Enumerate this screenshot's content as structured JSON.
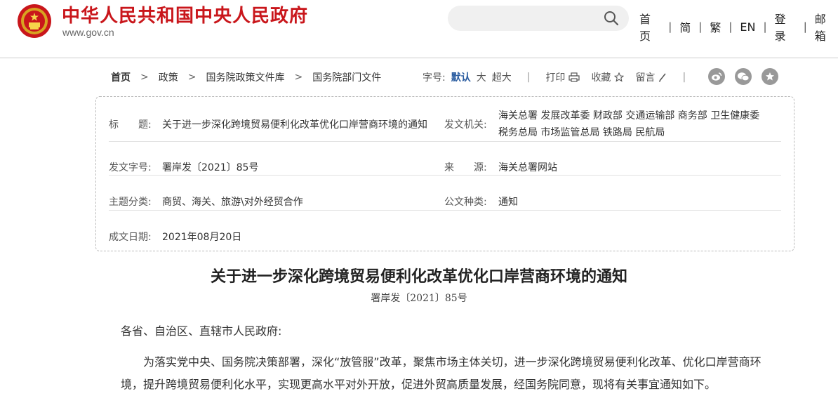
{
  "header": {
    "site_title": "中华人民共和国中央人民政府",
    "site_url": "www.gov.cn",
    "nav": [
      "首页",
      "简",
      "繁",
      "EN",
      "登录",
      "邮箱"
    ]
  },
  "breadcrumb": [
    "首页",
    "政策",
    "国务院政策文件库",
    "国务院部门文件"
  ],
  "toolbar": {
    "font_label": "字号:",
    "font_sizes": [
      "默认",
      "大",
      "超大"
    ],
    "print": "打印",
    "favorite": "收藏",
    "comment": "留言"
  },
  "info": {
    "title_label": "标　　题:",
    "title_value": "关于进一步深化跨境贸易便利化改革优化口岸营商环境的通知",
    "issuer_label": "发文机关:",
    "issuer_line1": "海关总署 发展改革委 财政部 交通运输部 商务部 卫生健康委",
    "issuer_line2": "税务总局 市场监管总局 铁路局 民航局",
    "docno_label": "发文字号:",
    "docno_value": "署岸发〔2021〕85号",
    "source_label": "来　　源:",
    "source_value": "海关总署网站",
    "topic_label": "主题分类:",
    "topic_value": "商贸、海关、旅游\\对外经贸合作",
    "doctype_label": "公文种类:",
    "doctype_value": "通知",
    "date_label": "成文日期:",
    "date_value": "2021年08月20日"
  },
  "document": {
    "title": "关于进一步深化跨境贸易便利化改革优化口岸营商环境的通知",
    "number": "署岸发〔2021〕85号",
    "salutation": "各省、自治区、直辖市人民政府:",
    "paragraph": "为落实党中央、国务院决策部署，深化“放管服”改革，聚焦市场主体关切，进一步深化跨境贸易便利化改革、优化口岸营商环境，提升跨境贸易便利化水平，实现更高水平对外开放，促进外贸高质量发展，经国务院同意，现将有关事宜通知如下。"
  },
  "colors": {
    "brand_red": "#c9161b",
    "link_blue": "#2a5ca0"
  },
  "icons": [
    "national-emblem-icon",
    "search-icon",
    "printer-icon",
    "star-icon",
    "pencil-icon",
    "weibo-icon",
    "wechat-icon",
    "favorite-star-icon"
  ]
}
